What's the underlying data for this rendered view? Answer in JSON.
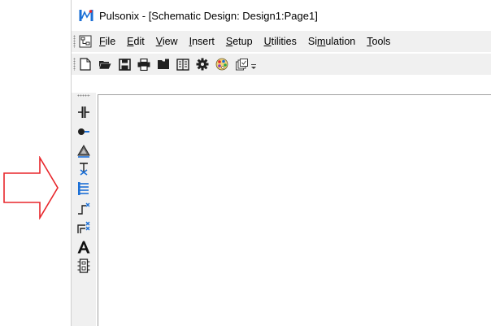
{
  "window": {
    "title": "Pulsonix - [Schematic Design: Design1:Page1]"
  },
  "menu": [
    {
      "pre": "",
      "mnemonic": "F",
      "post": "ile"
    },
    {
      "pre": "",
      "mnemonic": "E",
      "post": "dit"
    },
    {
      "pre": "",
      "mnemonic": "V",
      "post": "iew"
    },
    {
      "pre": "",
      "mnemonic": "I",
      "post": "nsert"
    },
    {
      "pre": "",
      "mnemonic": "S",
      "post": "etup"
    },
    {
      "pre": "",
      "mnemonic": "U",
      "post": "tilities"
    },
    {
      "pre": "Si",
      "mnemonic": "m",
      "post": "ulation"
    },
    {
      "pre": "",
      "mnemonic": "T",
      "post": "ools"
    }
  ],
  "toolbar": [
    "new-file-icon",
    "open-folder-icon",
    "save-icon",
    "print-icon",
    "open-design-icon",
    "library-icon",
    "settings-gear-icon",
    "colours-palette-icon",
    "windows-icon"
  ],
  "vertical_toolbar": [
    "capacitor-icon",
    "pin-icon",
    "power-symbol-icon",
    "ground-cross-icon",
    "bus-icon",
    "connector-icon",
    "multi-connector-icon",
    "text-icon",
    "component-icon"
  ],
  "colors": {
    "arrow": "#e8262b",
    "accent_blue": "#1b6fd6",
    "bar_bg": "#f0f0f0"
  }
}
